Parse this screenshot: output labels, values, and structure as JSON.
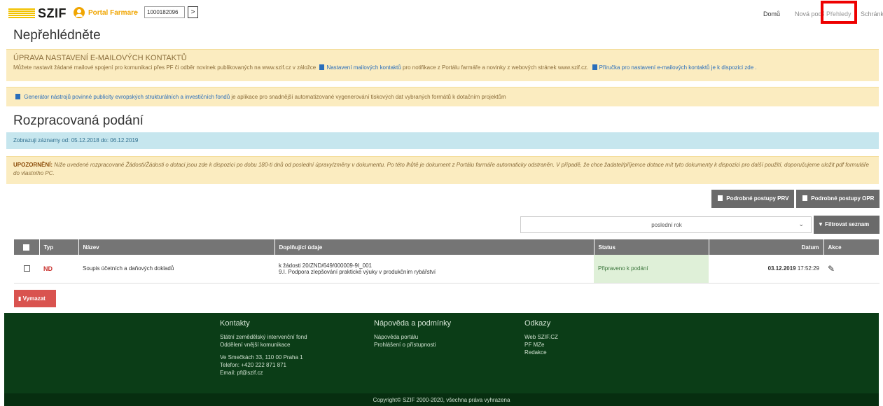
{
  "header": {
    "logo": "SZIF",
    "portal_name": "Portal Farmare",
    "id_value": "1000182096",
    "go_label": ">",
    "nav": {
      "home": "Domů",
      "new": "Nová podání",
      "overview": "Přehledy",
      "mailbox": "Schránka"
    }
  },
  "notice_title": "Nepřehlédněte",
  "email_alert": {
    "title": "ÚPRAVA NASTAVENÍ E-MAILOVÝCH KONTAKTŮ",
    "text1": "Můžete nastavit žádané mailové spojení pro komunikaci přes PF či odběr novinek publikovaných na www.szif.cz v záložce",
    "link1": "Nastavení mailových kontaktů",
    "text2": "pro notifikace z Portálu farmáře a novinky z webových stránek www.szif.cz.",
    "link2": "Příručka pro nastavení e-mailových kontaktů je k dispozici zde ."
  },
  "generator_alert": {
    "link": "Generátor nástrojů povinné publicity evropských strukturálních a investičních fondů",
    "text": "je aplikace pro snadnější automatizované vygenerování tiskových dat vybraných formátů k dotačním projektům"
  },
  "drafts_title": "Rozpracovaná podání",
  "range_info": "Zobrazuji záznamy od: 05.12.2018 do: 06.12.2019",
  "warning": {
    "label": "UPOZORNĚNÍ:",
    "text": "Níže uvedené rozpracované Žádosti/Žádosti o dotaci jsou zde k dispozici po dobu 180-ti dnů od poslední úpravy/změny v dokumentu. Po této lhůtě je dokument z Portálu farmáře automaticky odstraněn. V případě, že chce žadatel/příjemce dotace mít tyto dokumenty k dispozici pro další použití, doporučujeme uložit pdf formuláře do vlastního PC."
  },
  "buttons": {
    "prv": "Podrobné postupy PRV",
    "opr": "Podrobné postupy OPR",
    "filter": "Filtrovat seznam",
    "delete": "Vymazat"
  },
  "filter": {
    "selected": "poslední rok"
  },
  "table": {
    "headers": {
      "type": "Typ",
      "name": "Název",
      "extra": "Doplňující údaje",
      "status": "Status",
      "date": "Datum",
      "action": "Akce"
    },
    "rows": [
      {
        "type": "ND",
        "name": "Soupis účetních a daňových dokladů",
        "extra1": "k žádosti 20/ZND/649/000009-9I_001",
        "extra2": "9.I. Podpora zlepšování praktické výuky v produkčním rybářství",
        "status": "Připraveno k podání",
        "date": "03.12.2019",
        "time": "17:52:29"
      }
    ]
  },
  "footer": {
    "contacts": {
      "title": "Kontakty",
      "l1": "Státní zemědělský intervenční fond",
      "l2": "Oddělení vnější komunikace",
      "l3": "Ve Smečkách 33, 110 00 Praha 1",
      "l4": "Telefon: +420 222 871 871",
      "l5": "Email: pf@szif.cz"
    },
    "help": {
      "title": "Nápověda a podmínky",
      "l1": "Nápověda portálu",
      "l2": "Prohlášení o přístupnosti"
    },
    "links": {
      "title": "Odkazy",
      "l1": "Web SZIF.CZ",
      "l2": "PF MZe",
      "l3": "Redakce"
    },
    "copyright": "Copyright© SZIF 2000-2020, všechna práva vyhrazena"
  },
  "colors": {
    "brand_yellow": "#f2c200",
    "accent_orange": "#f0a500",
    "footer_green": "#0b3d17",
    "danger": "#d9534f",
    "highlight_box": "#ee0000"
  }
}
